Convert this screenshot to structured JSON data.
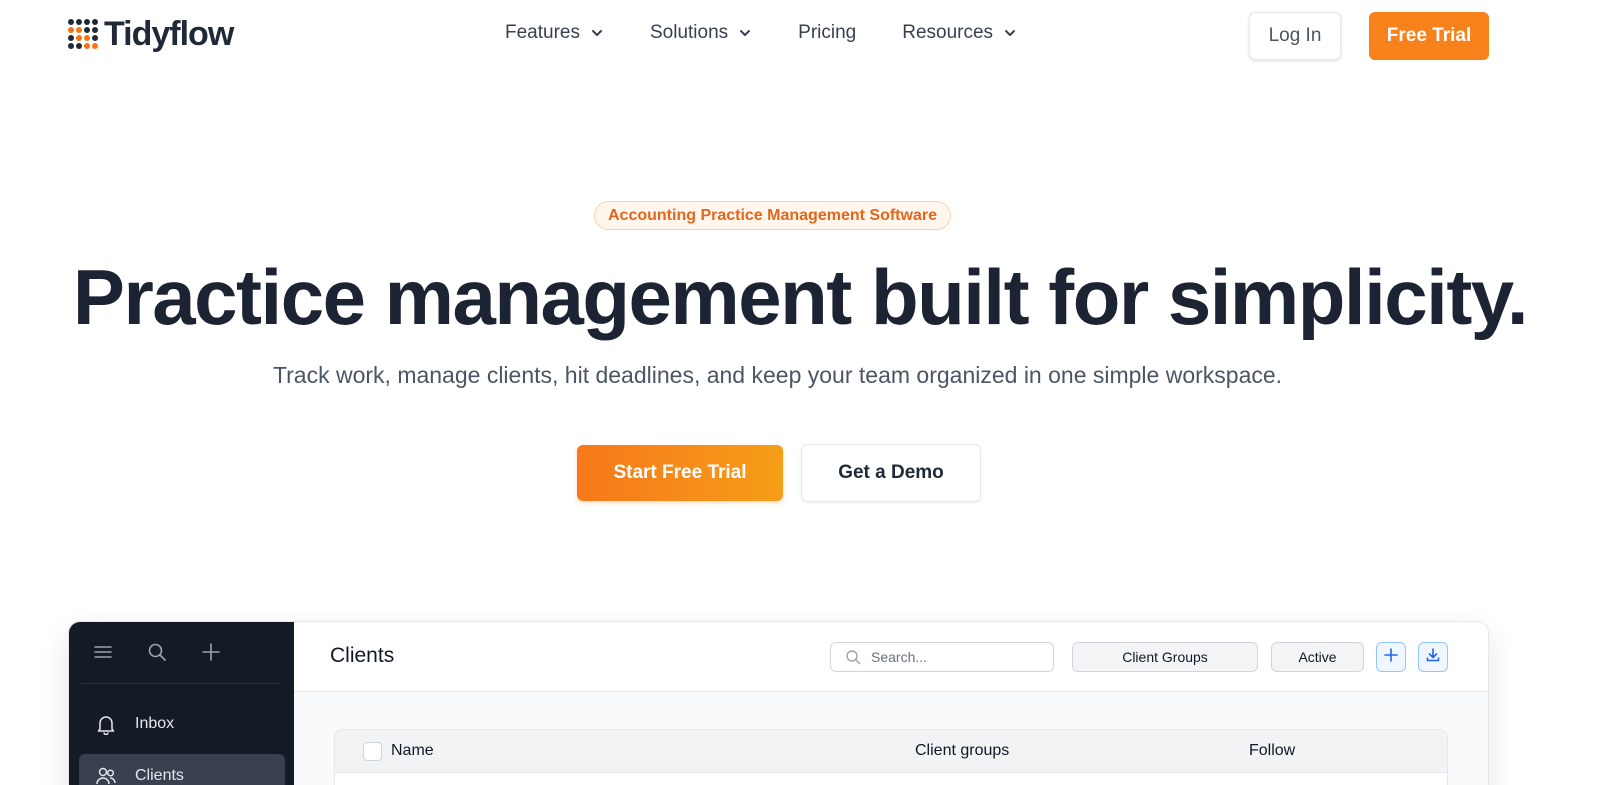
{
  "brand": {
    "name": "Tidyflow"
  },
  "nav": {
    "items": [
      {
        "label": "Features",
        "dropdown": true
      },
      {
        "label": "Solutions",
        "dropdown": true
      },
      {
        "label": "Pricing",
        "dropdown": false
      },
      {
        "label": "Resources",
        "dropdown": true
      }
    ],
    "login_label": "Log In",
    "trial_label": "Free Trial"
  },
  "hero": {
    "badge": "Accounting Practice Management Software",
    "headline": "Practice management built for simplicity.",
    "subline": "Track work, manage clients, hit deadlines, and keep your team organized in one simple workspace.",
    "primary_cta": "Start Free Trial",
    "secondary_cta": "Get a Demo"
  },
  "app_preview": {
    "sidebar": {
      "tools": [
        "menu-icon",
        "search-icon",
        "plus-icon"
      ],
      "items": [
        {
          "label": "Inbox",
          "icon": "bell-icon",
          "active": false
        },
        {
          "label": "Clients",
          "icon": "users-icon",
          "active": true
        }
      ]
    },
    "header": {
      "title": "Clients",
      "search_placeholder": "Search...",
      "filters": [
        "Client Groups",
        "Active"
      ],
      "actions": [
        "plus-icon",
        "download-icon"
      ]
    },
    "table": {
      "columns": [
        "Name",
        "Client groups",
        "Follow"
      ]
    }
  },
  "colors": {
    "accent": "#f7821b",
    "text_dark": "#1c2433",
    "sidebar_bg": "#141a26",
    "sidebar_active": "#394150"
  }
}
